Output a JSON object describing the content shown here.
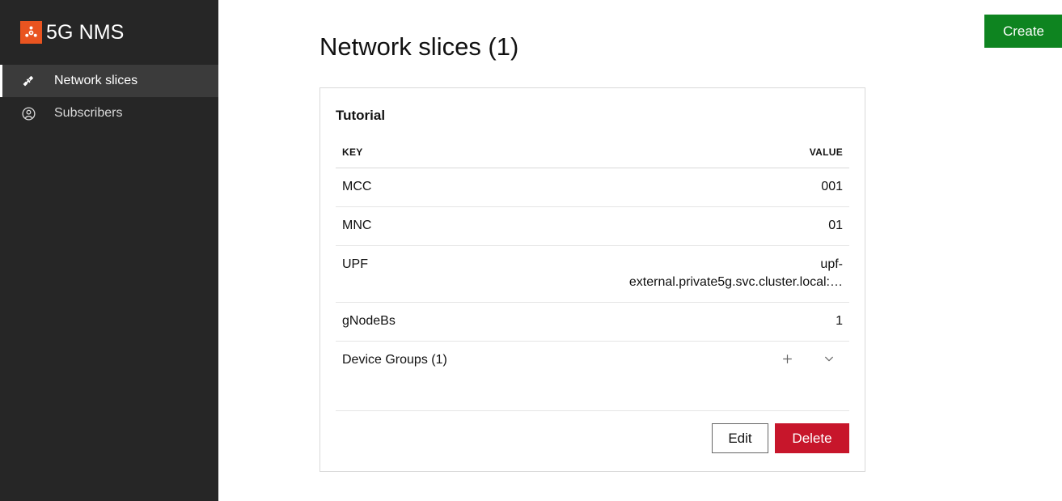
{
  "sidebar": {
    "brand": {
      "name": "5G NMS",
      "logo_icon": "ubuntu-circle-of-friends-icon",
      "logo_color": "#E95420"
    },
    "items": [
      {
        "label": "Network slices",
        "icon": "network-plug-icon",
        "active": true
      },
      {
        "label": "Subscribers",
        "icon": "user-circle-icon",
        "active": false
      }
    ],
    "background_color": "#262626",
    "active_background_color": "#3b3b3b"
  },
  "header": {
    "title": "Network slices (1)",
    "create_label": "Create",
    "create_color": "#0E8420"
  },
  "card": {
    "title": "Tutorial",
    "table": {
      "columns": [
        "KEY",
        "VALUE"
      ],
      "rows": [
        {
          "key": "MCC",
          "value": "001"
        },
        {
          "key": "MNC",
          "value": "01"
        },
        {
          "key": "UPF",
          "value_line1": "upf-",
          "value_line2": "external.private5g.svc.cluster.local:…"
        },
        {
          "key": "gNodeBs",
          "value": "1"
        },
        {
          "key": "Device Groups (1)",
          "value": ""
        }
      ]
    },
    "device_groups": {
      "add_icon": "plus-icon",
      "expand_icon": "chevron-down-icon"
    },
    "actions": {
      "edit_label": "Edit",
      "delete_label": "Delete",
      "delete_color": "#C7162B"
    }
  }
}
